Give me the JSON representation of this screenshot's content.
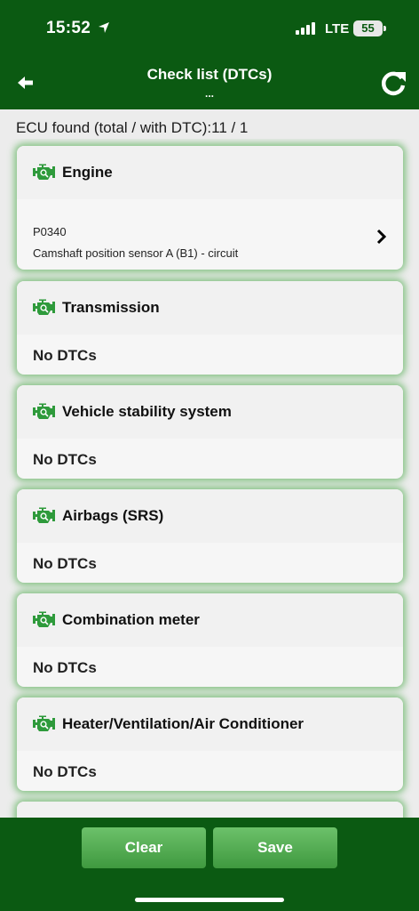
{
  "status_bar": {
    "time": "15:52",
    "network": "LTE",
    "battery": "55"
  },
  "header": {
    "title": "Check list (DTCs)",
    "subtitle": "..."
  },
  "summary": "ECU found (total / with DTC):11 / 1",
  "cards": [
    {
      "title": "Engine",
      "dtc_code": "P0340",
      "dtc_description": "Camshaft position sensor A (B1) - circuit"
    },
    {
      "title": "Transmission",
      "status": "No DTCs"
    },
    {
      "title": "Vehicle stability system",
      "status": "No DTCs"
    },
    {
      "title": "Airbags (SRS)",
      "status": "No DTCs"
    },
    {
      "title": "Combination meter",
      "status": "No DTCs"
    },
    {
      "title": "Heater/Ventilation/Air Conditioner",
      "status": "No DTCs"
    }
  ],
  "footer": {
    "clear_label": "Clear",
    "save_label": "Save"
  },
  "colors": {
    "brand_green": "#0b5a12",
    "icon_green": "#2e9a3b",
    "button_green": "#4fa84d"
  },
  "icons": {
    "back": "arrow-left-icon",
    "refresh": "refresh-icon",
    "ecu": "engine-search-icon",
    "chevron": "chevron-right-icon"
  }
}
